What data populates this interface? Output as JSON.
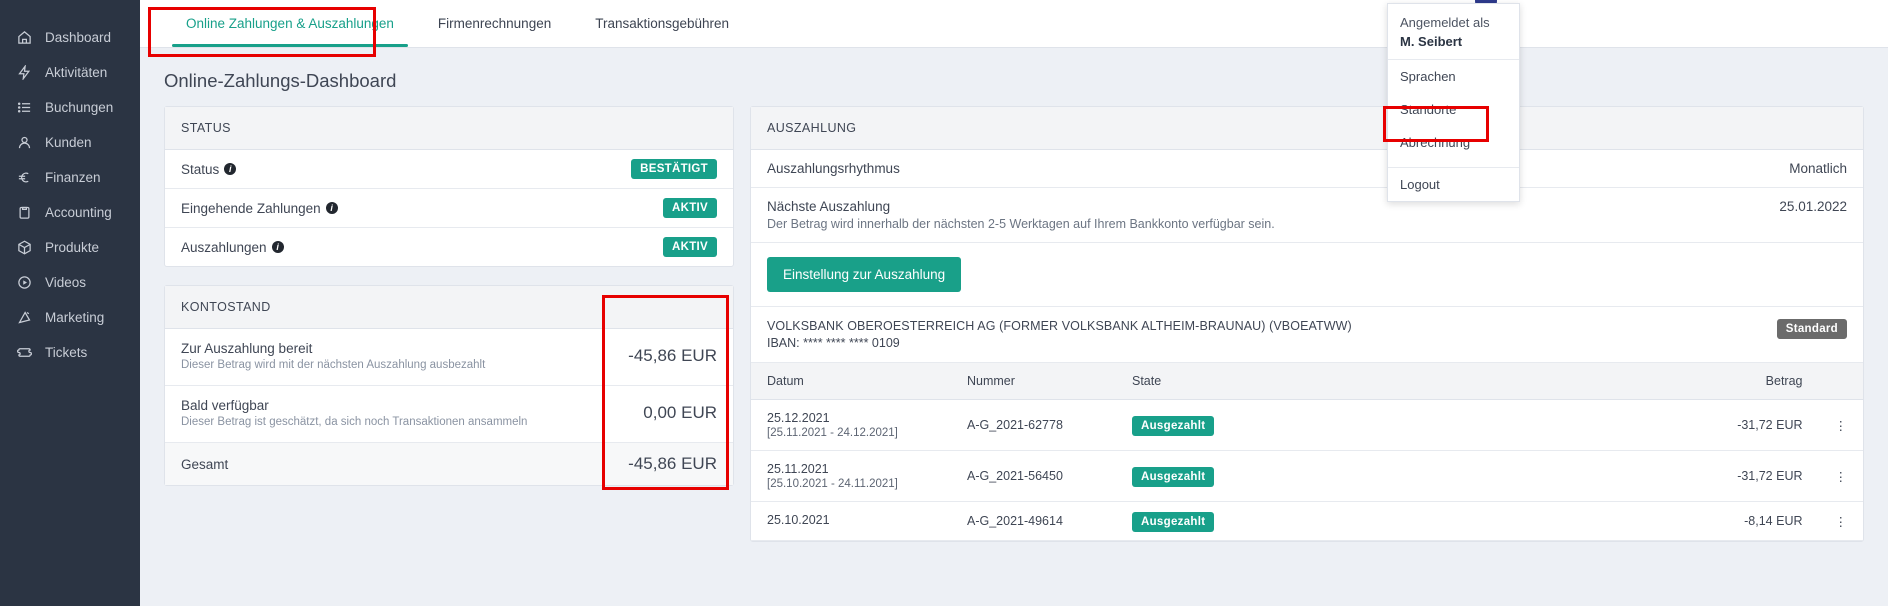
{
  "sidebar": {
    "items": [
      {
        "label": "Dashboard",
        "icon": "home-icon"
      },
      {
        "label": "Aktivitäten",
        "icon": "lightning-icon"
      },
      {
        "label": "Buchungen",
        "icon": "list-icon"
      },
      {
        "label": "Kunden",
        "icon": "user-icon"
      },
      {
        "label": "Finanzen",
        "icon": "euro-icon"
      },
      {
        "label": "Accounting",
        "icon": "clipboard-icon"
      },
      {
        "label": "Produkte",
        "icon": "box-icon"
      },
      {
        "label": "Videos",
        "icon": "play-circle-icon"
      },
      {
        "label": "Marketing",
        "icon": "megaphone-icon"
      },
      {
        "label": "Tickets",
        "icon": "ticket-icon"
      }
    ]
  },
  "tabs": [
    {
      "label": "Online Zahlungen & Auszahlungen",
      "active": true
    },
    {
      "label": "Firmenrechnungen",
      "active": false
    },
    {
      "label": "Transaktionsgebühren",
      "active": false
    }
  ],
  "page": {
    "title": "Online-Zahlungs-Dashboard"
  },
  "account_menu": {
    "logged_in_as_label": "Angemeldet als",
    "user_name": "M. Seibert",
    "items": [
      {
        "label": "Sprachen"
      },
      {
        "label": "Standorte"
      },
      {
        "label": "Abrechnung"
      },
      {
        "label": "Logout"
      }
    ]
  },
  "status_card": {
    "title": "STATUS",
    "rows": [
      {
        "label": "Status",
        "info": true,
        "badge": "BESTÄTIGT"
      },
      {
        "label": "Eingehende Zahlungen",
        "info": true,
        "badge": "AKTIV"
      },
      {
        "label": "Auszahlungen",
        "info": true,
        "badge": "AKTIV"
      }
    ]
  },
  "balance_card": {
    "title": "KONTOSTAND",
    "rows": [
      {
        "name": "Zur Auszahlung bereit",
        "desc": "Dieser Betrag wird mit der nächsten Auszahlung ausbezahlt",
        "amount": "-45,86 EUR"
      },
      {
        "name": "Bald verfügbar",
        "desc": "Dieser Betrag ist geschätzt, da sich noch Transaktionen ansammeln",
        "amount": "0,00 EUR"
      },
      {
        "name": "Gesamt",
        "desc": "",
        "amount": "-45,86 EUR"
      }
    ]
  },
  "payout_card": {
    "title": "AUSZAHLUNG",
    "rhythm_label": "Auszahlungsrhythmus",
    "rhythm_value": "Monatlich",
    "next_label": "Nächste Auszahlung",
    "next_note": "Der Betrag wird innerhalb der nächsten 2-5 Werktagen auf Ihrem Bankkonto verfügbar sein.",
    "next_value": "25.01.2022",
    "settings_button": "Einstellung zur Auszahlung",
    "bank_name": "VOLKSBANK OBEROESTERREICH AG (FORMER VOLKSBANK ALTHEIM-BRAUNAU) (VBOEATWW)",
    "bank_iban": "IBAN: **** **** **** 0109",
    "bank_badge": "Standard",
    "table": {
      "columns": [
        "Datum",
        "Nummer",
        "State",
        "Betrag"
      ],
      "rows": [
        {
          "date": "25.12.2021",
          "range": "[25.11.2021 - 24.12.2021]",
          "number": "A-G_2021-62778",
          "state": "Ausgezahlt",
          "amount": "-31,72 EUR"
        },
        {
          "date": "25.11.2021",
          "range": "[25.10.2021 - 24.11.2021]",
          "number": "A-G_2021-56450",
          "state": "Ausgezahlt",
          "amount": "-31,72 EUR"
        },
        {
          "date": "25.10.2021",
          "range": "",
          "number": "A-G_2021-49614",
          "state": "Ausgezahlt",
          "amount": "-8,14 EUR"
        }
      ]
    }
  },
  "colors": {
    "accent": "#18a08a",
    "sidebar": "#2b3443",
    "annotation": "#e70000",
    "badge_gray": "#6b6b6b"
  }
}
